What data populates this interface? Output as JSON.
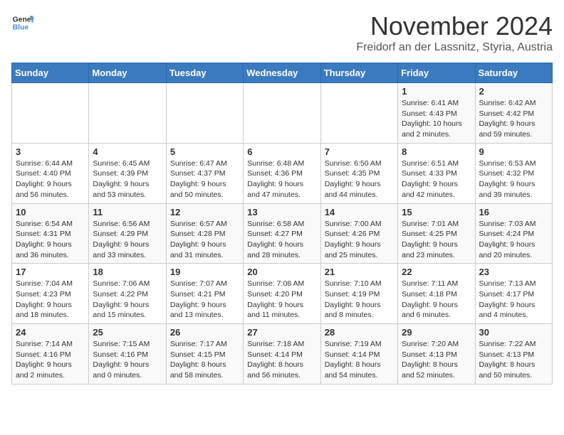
{
  "logo": {
    "general": "General",
    "blue": "Blue"
  },
  "title": "November 2024",
  "location": "Freidorf an der Lassnitz, Styria, Austria",
  "days_of_week": [
    "Sunday",
    "Monday",
    "Tuesday",
    "Wednesday",
    "Thursday",
    "Friday",
    "Saturday"
  ],
  "weeks": [
    [
      {
        "day": "",
        "info": ""
      },
      {
        "day": "",
        "info": ""
      },
      {
        "day": "",
        "info": ""
      },
      {
        "day": "",
        "info": ""
      },
      {
        "day": "",
        "info": ""
      },
      {
        "day": "1",
        "info": "Sunrise: 6:41 AM\nSunset: 4:43 PM\nDaylight: 10 hours\nand 2 minutes."
      },
      {
        "day": "2",
        "info": "Sunrise: 6:42 AM\nSunset: 4:42 PM\nDaylight: 9 hours\nand 59 minutes."
      }
    ],
    [
      {
        "day": "3",
        "info": "Sunrise: 6:44 AM\nSunset: 4:40 PM\nDaylight: 9 hours\nand 56 minutes."
      },
      {
        "day": "4",
        "info": "Sunrise: 6:45 AM\nSunset: 4:39 PM\nDaylight: 9 hours\nand 53 minutes."
      },
      {
        "day": "5",
        "info": "Sunrise: 6:47 AM\nSunset: 4:37 PM\nDaylight: 9 hours\nand 50 minutes."
      },
      {
        "day": "6",
        "info": "Sunrise: 6:48 AM\nSunset: 4:36 PM\nDaylight: 9 hours\nand 47 minutes."
      },
      {
        "day": "7",
        "info": "Sunrise: 6:50 AM\nSunset: 4:35 PM\nDaylight: 9 hours\nand 44 minutes."
      },
      {
        "day": "8",
        "info": "Sunrise: 6:51 AM\nSunset: 4:33 PM\nDaylight: 9 hours\nand 42 minutes."
      },
      {
        "day": "9",
        "info": "Sunrise: 6:53 AM\nSunset: 4:32 PM\nDaylight: 9 hours\nand 39 minutes."
      }
    ],
    [
      {
        "day": "10",
        "info": "Sunrise: 6:54 AM\nSunset: 4:31 PM\nDaylight: 9 hours\nand 36 minutes."
      },
      {
        "day": "11",
        "info": "Sunrise: 6:56 AM\nSunset: 4:29 PM\nDaylight: 9 hours\nand 33 minutes."
      },
      {
        "day": "12",
        "info": "Sunrise: 6:57 AM\nSunset: 4:28 PM\nDaylight: 9 hours\nand 31 minutes."
      },
      {
        "day": "13",
        "info": "Sunrise: 6:58 AM\nSunset: 4:27 PM\nDaylight: 9 hours\nand 28 minutes."
      },
      {
        "day": "14",
        "info": "Sunrise: 7:00 AM\nSunset: 4:26 PM\nDaylight: 9 hours\nand 25 minutes."
      },
      {
        "day": "15",
        "info": "Sunrise: 7:01 AM\nSunset: 4:25 PM\nDaylight: 9 hours\nand 23 minutes."
      },
      {
        "day": "16",
        "info": "Sunrise: 7:03 AM\nSunset: 4:24 PM\nDaylight: 9 hours\nand 20 minutes."
      }
    ],
    [
      {
        "day": "17",
        "info": "Sunrise: 7:04 AM\nSunset: 4:23 PM\nDaylight: 9 hours\nand 18 minutes."
      },
      {
        "day": "18",
        "info": "Sunrise: 7:06 AM\nSunset: 4:22 PM\nDaylight: 9 hours\nand 15 minutes."
      },
      {
        "day": "19",
        "info": "Sunrise: 7:07 AM\nSunset: 4:21 PM\nDaylight: 9 hours\nand 13 minutes."
      },
      {
        "day": "20",
        "info": "Sunrise: 7:08 AM\nSunset: 4:20 PM\nDaylight: 9 hours\nand 11 minutes."
      },
      {
        "day": "21",
        "info": "Sunrise: 7:10 AM\nSunset: 4:19 PM\nDaylight: 9 hours\nand 8 minutes."
      },
      {
        "day": "22",
        "info": "Sunrise: 7:11 AM\nSunset: 4:18 PM\nDaylight: 9 hours\nand 6 minutes."
      },
      {
        "day": "23",
        "info": "Sunrise: 7:13 AM\nSunset: 4:17 PM\nDaylight: 9 hours\nand 4 minutes."
      }
    ],
    [
      {
        "day": "24",
        "info": "Sunrise: 7:14 AM\nSunset: 4:16 PM\nDaylight: 9 hours\nand 2 minutes."
      },
      {
        "day": "25",
        "info": "Sunrise: 7:15 AM\nSunset: 4:16 PM\nDaylight: 9 hours\nand 0 minutes."
      },
      {
        "day": "26",
        "info": "Sunrise: 7:17 AM\nSunset: 4:15 PM\nDaylight: 8 hours\nand 58 minutes."
      },
      {
        "day": "27",
        "info": "Sunrise: 7:18 AM\nSunset: 4:14 PM\nDaylight: 8 hours\nand 56 minutes."
      },
      {
        "day": "28",
        "info": "Sunrise: 7:19 AM\nSunset: 4:14 PM\nDaylight: 8 hours\nand 54 minutes."
      },
      {
        "day": "29",
        "info": "Sunrise: 7:20 AM\nSunset: 4:13 PM\nDaylight: 8 hours\nand 52 minutes."
      },
      {
        "day": "30",
        "info": "Sunrise: 7:22 AM\nSunset: 4:13 PM\nDaylight: 8 hours\nand 50 minutes."
      }
    ]
  ]
}
